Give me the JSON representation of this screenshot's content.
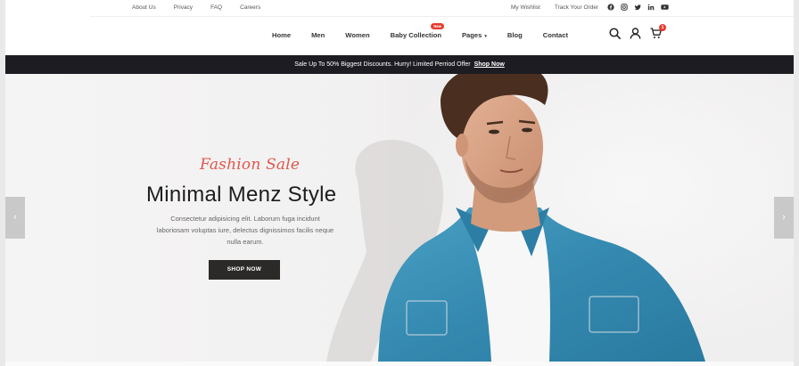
{
  "topbar": {
    "links_left": [
      "About Us",
      "Privacy",
      "FAQ",
      "Careers"
    ],
    "links_right": [
      "My Wishlist",
      "Track Your Order"
    ],
    "socials": [
      "facebook-icon",
      "instagram-icon",
      "twitter-icon",
      "linkedin-icon",
      "youtube-icon"
    ]
  },
  "nav": {
    "items": [
      {
        "label": "Home"
      },
      {
        "label": "Men"
      },
      {
        "label": "Women"
      },
      {
        "label": "Baby Collection",
        "badge": "New"
      },
      {
        "label": "Pages",
        "caret": "▾"
      },
      {
        "label": "Blog"
      },
      {
        "label": "Contact"
      }
    ],
    "icons": [
      "search-icon",
      "user-icon",
      "cart-icon"
    ],
    "cart_count": "1"
  },
  "announcement": {
    "text": "Sale Up To 50% Biggest Discounts. Hurry! Limited Perriod Offer",
    "link": "Shop Now"
  },
  "hero": {
    "subtitle": "Fashion Sale",
    "title": "Minimal Menz Style",
    "description": "Consectetur adipisicing elit. Laborum fuga incidunt laboriosam voluptas iure, delectus dignissimos facilis neque nulla earum.",
    "button": "SHOP NOW",
    "prev": "‹",
    "next": "›"
  },
  "colors": {
    "accent": "#e0574e",
    "badge": "#e63b2e",
    "announce_bg": "#1c1c22",
    "button_bg": "#2c2a28",
    "shirt": "#3a8fb5"
  }
}
